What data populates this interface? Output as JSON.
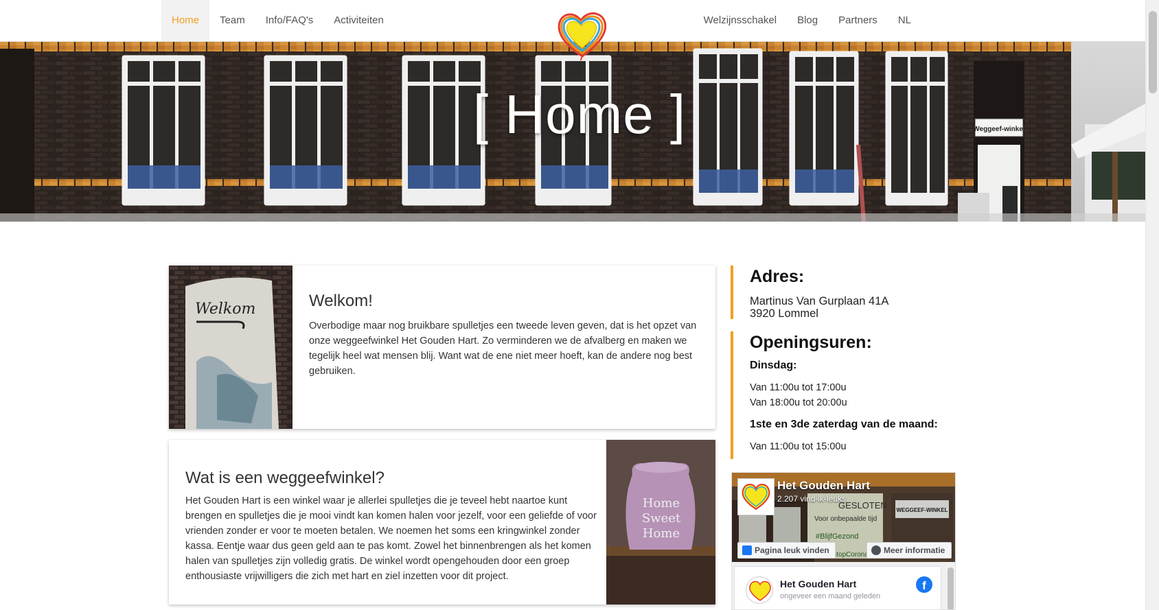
{
  "nav": {
    "left": [
      {
        "label": "Home",
        "active": true
      },
      {
        "label": "Team"
      },
      {
        "label": "Info/FAQ's"
      },
      {
        "label": "Activiteiten"
      }
    ],
    "right": [
      {
        "label": "Welzijnsschakel"
      },
      {
        "label": "Blog"
      },
      {
        "label": "Partners"
      },
      {
        "label": "NL"
      }
    ],
    "logo_icon": "heart-logo-icon"
  },
  "hero": {
    "title": "[ Home ]",
    "sign_text": "Weggeef-winkel"
  },
  "cards": [
    {
      "title": "Welkom!",
      "text": "Overbodige maar nog bruikbare spulletjes een tweede leven geven, dat is het opzet van onze weggeefwinkel Het Gouden Hart. Zo verminderen we de afvalberg en maken we tegelijk heel wat mensen blij. Want wat de ene niet meer hoeft, kan de andere nog best gebruiken.",
      "image_text": "Welkom"
    },
    {
      "title": "Wat is een weggeefwinkel?",
      "text": "Het Gouden Hart is een winkel waar je allerlei spulletjes die je teveel hebt naartoe kunt brengen en spulletjes die je mooi vindt kan komen halen voor jezelf, voor een geliefde of voor vrienden zonder er voor te moeten betalen. We noemen het soms een kringwinkel zonder kassa. Eentje waar dus geen geld aan te pas komt. Zowel het binnenbrengen als het komen halen van spulletjes zijn volledig gratis. De winkel wordt opengehouden door een groep enthousiaste vrijwilligers die zich met hart en ziel inzetten voor dit project.",
      "image_text": [
        "Home",
        "Sweet",
        "Home"
      ]
    }
  ],
  "address": {
    "heading": "Adres:",
    "line1": "Martinus Van Gurplaan 41A",
    "line2": "3920 Lommel"
  },
  "hours": {
    "heading": "Openingsuren:",
    "day1": "Dinsdag:",
    "day1_slot1": "Van 11:00u tot 17:00u",
    "day1_slot2": "Van 18:00u tot 20:00u",
    "day2": "1ste en 3de zaterdag van de maand:",
    "day2_slot1": "Van 11:00u tot 15:00u"
  },
  "facebook": {
    "page_name": "Het Gouden Hart",
    "likes": "2.207 vind-ik-leuks",
    "like_button": "Pagina leuk vinden",
    "info_button": "Meer informatie",
    "post_name": "Het Gouden Hart",
    "post_time": "ongeveer een maand geleden",
    "cover_sign_lines": [
      "GESLOTEN",
      "Voor onbepaalde tijd",
      "#BlijfGezond",
      "#StopCorona"
    ],
    "cover_top_sign": "WEGGEEF-WINKEL"
  },
  "colors": {
    "accent": "#f0a020",
    "facebook_blue": "#1877f2"
  }
}
